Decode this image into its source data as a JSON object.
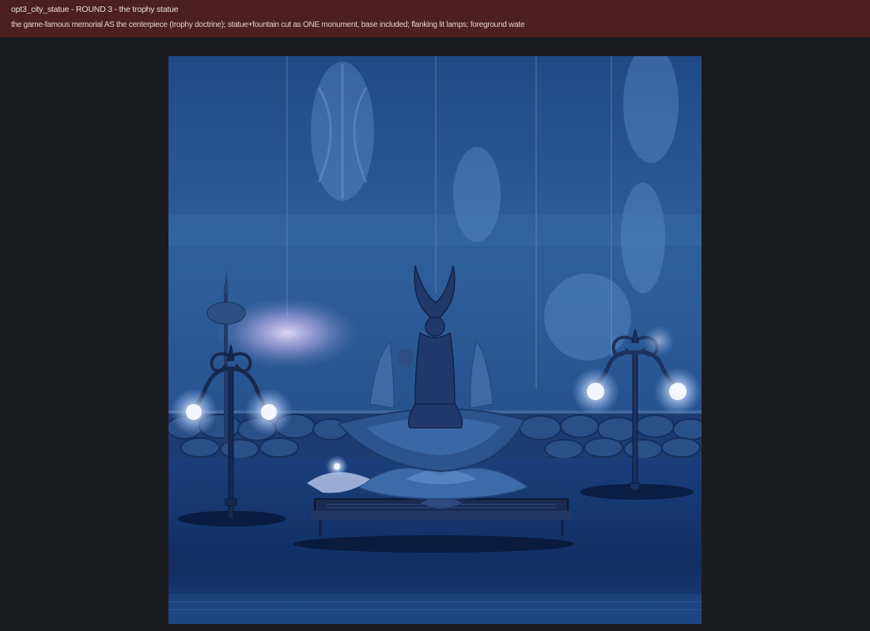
{
  "header": {
    "title": "opt3_city_statue - ROUND 3 - the trophy statue",
    "subtitle": "the game-famous memorial AS the centerpiece (trophy doctrine); statue+fountain cut as ONE monument, base included; flanking lit lamps; foreground wate"
  },
  "colors": {
    "header_bg": "#4e1f20",
    "page_bg": "#1a1b1e",
    "scene_sky": "#2f5c97",
    "scene_deep": "#0c1d44",
    "lamp_glow": "#e8f3ff"
  },
  "scene": {
    "name": "city-statue-render",
    "icons": [
      "statue-icon",
      "lamp-icon",
      "fountain-icon"
    ]
  }
}
